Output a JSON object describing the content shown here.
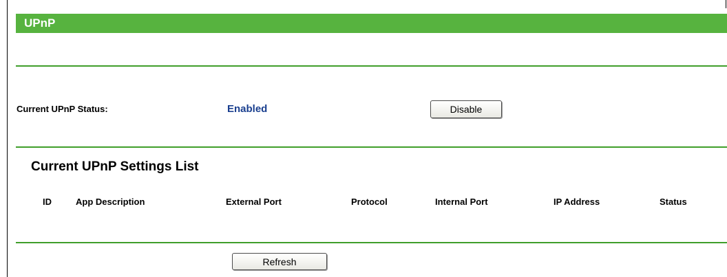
{
  "header": {
    "title": "UPnP"
  },
  "status": {
    "label": "Current UPnP Status:",
    "value": "Enabled",
    "toggle_button_label": "Disable"
  },
  "settings_list": {
    "title": "Current UPnP Settings List",
    "columns": [
      "ID",
      "App Description",
      "External Port",
      "Protocol",
      "Internal Port",
      "IP Address",
      "Status"
    ],
    "rows": []
  },
  "footer": {
    "refresh_label": "Refresh"
  },
  "colors": {
    "title_bar": "#57b33f",
    "divider": "#3f9e2a",
    "status_enabled": "#1a3f8f"
  }
}
